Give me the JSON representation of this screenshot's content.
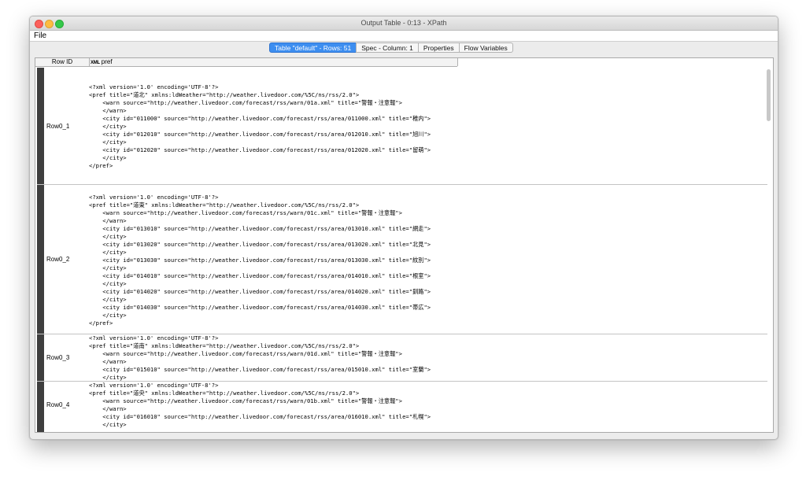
{
  "window": {
    "title": "Output Table - 0:13 - XPath"
  },
  "menu": {
    "file": "File"
  },
  "tabs": [
    {
      "label": "Table \"default\" - Rows: 51"
    },
    {
      "label": "Spec - Column: 1"
    },
    {
      "label": "Properties"
    },
    {
      "label": "Flow Variables"
    }
  ],
  "table": {
    "columns": {
      "row_id": "Row ID",
      "pref_badge": "XML",
      "pref": "pref"
    },
    "rows": [
      {
        "id": "Row0_1",
        "content": "<?xml version='1.0' encoding='UTF-8'?>\n<pref title=\"道北\" xmlns:ldWeather=\"http://weather.livedoor.com/%5C/ns/rss/2.0\">\n    <warn source=\"http://weather.livedoor.com/forecast/rss/warn/01a.xml\" title=\"警報・注意報\">\n    </warn>\n    <city id=\"011000\" source=\"http://weather.livedoor.com/forecast/rss/area/011000.xml\" title=\"稚内\">\n    </city>\n    <city id=\"012010\" source=\"http://weather.livedoor.com/forecast/rss/area/012010.xml\" title=\"旭川\">\n    </city>\n    <city id=\"012020\" source=\"http://weather.livedoor.com/forecast/rss/area/012020.xml\" title=\"留萌\">\n    </city>\n</pref>"
      },
      {
        "id": "Row0_2",
        "content": "<?xml version='1.0' encoding='UTF-8'?>\n<pref title=\"道東\" xmlns:ldWeather=\"http://weather.livedoor.com/%5C/ns/rss/2.0\">\n    <warn source=\"http://weather.livedoor.com/forecast/rss/warn/01c.xml\" title=\"警報・注意報\">\n    </warn>\n    <city id=\"013010\" source=\"http://weather.livedoor.com/forecast/rss/area/013010.xml\" title=\"網走\">\n    </city>\n    <city id=\"013020\" source=\"http://weather.livedoor.com/forecast/rss/area/013020.xml\" title=\"北見\">\n    </city>\n    <city id=\"013030\" source=\"http://weather.livedoor.com/forecast/rss/area/013030.xml\" title=\"紋別\">\n    </city>\n    <city id=\"014010\" source=\"http://weather.livedoor.com/forecast/rss/area/014010.xml\" title=\"根室\">\n    </city>\n    <city id=\"014020\" source=\"http://weather.livedoor.com/forecast/rss/area/014020.xml\" title=\"釧路\">\n    </city>\n    <city id=\"014030\" source=\"http://weather.livedoor.com/forecast/rss/area/014030.xml\" title=\"帯広\">\n    </city>\n</pref>"
      },
      {
        "id": "Row0_3",
        "content": "<?xml version='1.0' encoding='UTF-8'?>\n<pref title=\"道南\" xmlns:ldWeather=\"http://weather.livedoor.com/%5C/ns/rss/2.0\">\n    <warn source=\"http://weather.livedoor.com/forecast/rss/warn/01d.xml\" title=\"警報・注意報\">\n    </warn>\n    <city id=\"015010\" source=\"http://weather.livedoor.com/forecast/rss/area/015010.xml\" title=\"室蘭\">\n    </city>"
      },
      {
        "id": "Row0_4",
        "content": "<?xml version='1.0' encoding='UTF-8'?>\n<pref title=\"道央\" xmlns:ldWeather=\"http://weather.livedoor.com/%5C/ns/rss/2.0\">\n    <warn source=\"http://weather.livedoor.com/forecast/rss/warn/01b.xml\" title=\"警報・注意報\">\n    </warn>\n    <city id=\"016010\" source=\"http://weather.livedoor.com/forecast/rss/area/016010.xml\" title=\"札幌\">\n    </city>"
      }
    ]
  }
}
